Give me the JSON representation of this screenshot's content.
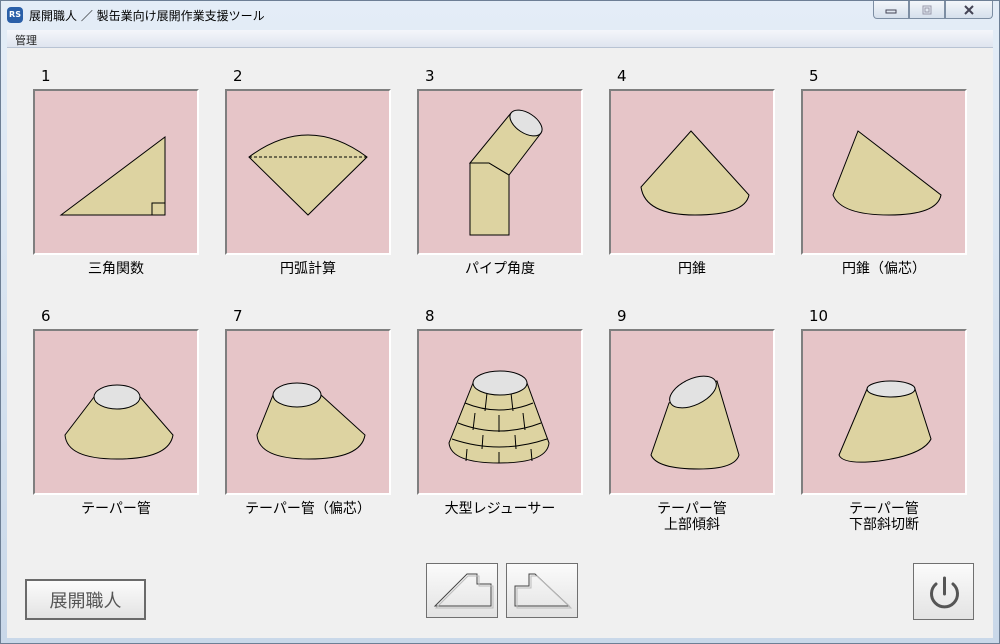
{
  "window": {
    "title": "展開職人 ／ 製缶業向け展開作業支援ツール",
    "icon_text": "RS",
    "icon": "app-logo-icon",
    "controls": {
      "minimize": "minimize-icon",
      "maximize": "maximize-icon",
      "close": "close-icon"
    }
  },
  "menu": {
    "items": [
      {
        "label": "管理"
      }
    ]
  },
  "cards": [
    {
      "number": "1",
      "label": "三角関数",
      "icon": "right-triangle-icon"
    },
    {
      "number": "2",
      "label": "円弧計算",
      "icon": "circular-segment-icon"
    },
    {
      "number": "3",
      "label": "パイプ角度",
      "icon": "bent-pipe-icon"
    },
    {
      "number": "4",
      "label": "円錐",
      "icon": "cone-icon"
    },
    {
      "number": "5",
      "label": "円錐（偏芯）",
      "icon": "eccentric-cone-icon"
    },
    {
      "number": "6",
      "label": "テーパー管",
      "icon": "taper-pipe-icon"
    },
    {
      "number": "7",
      "label": "テーパー管（偏芯）",
      "icon": "eccentric-taper-pipe-icon"
    },
    {
      "number": "8",
      "label": "大型レジューサー",
      "icon": "large-reducer-icon"
    },
    {
      "number": "9",
      "label": "テーパー管",
      "label2": "上部傾斜",
      "icon": "inclined-top-taper-pipe-icon"
    },
    {
      "number": "10",
      "label": "テーパー管",
      "label2": "下部斜切断",
      "icon": "oblique-bottom-taper-pipe-icon"
    }
  ],
  "footer": {
    "app_button_label": "展開職人",
    "prev_icon": "prev-shape-icon",
    "next_icon": "next-shape-icon",
    "power_icon": "power-icon"
  },
  "colors": {
    "tile_bg": "#e6c5c8",
    "shape_fill": "#ddd3a1",
    "ellipse_fill": "#e2e2e2"
  }
}
